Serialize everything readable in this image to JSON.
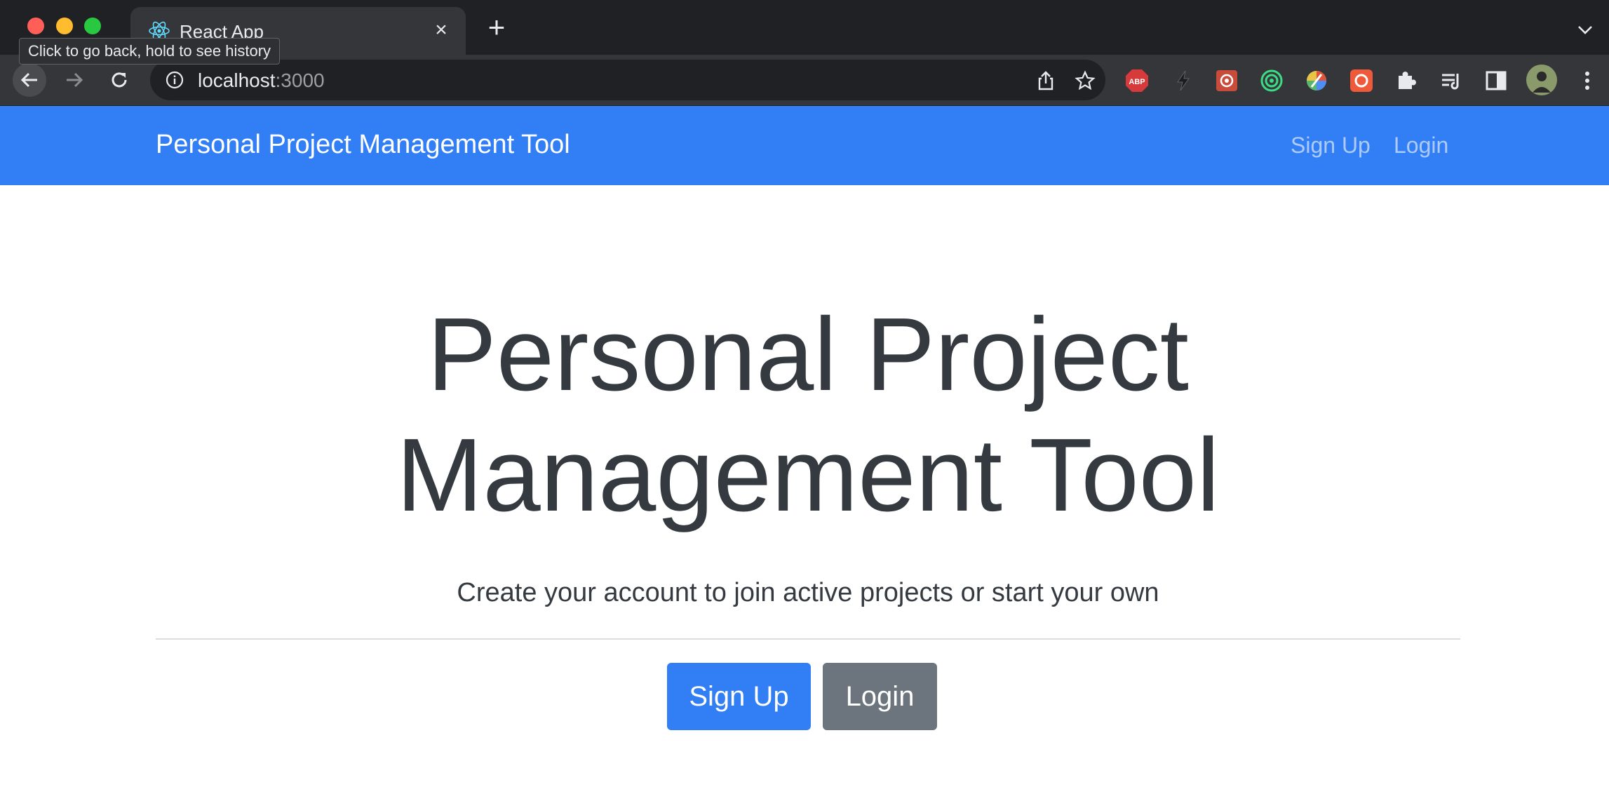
{
  "browser": {
    "tab_title": "React App",
    "close_glyph": "×",
    "new_tab_glyph": "+",
    "tooltip": "Click to go back, hold to see history",
    "url_host": "localhost",
    "url_port": ":3000",
    "extensions": [
      "abp-icon",
      "bolt-icon",
      "extension-red-icon",
      "target-icon",
      "color-picker-icon",
      "record-icon",
      "puzzle-icon",
      "reading-list-icon",
      "side-panel-icon",
      "avatar",
      "more-icon"
    ],
    "colors": {
      "frame": "#202124",
      "toolbar": "#35363a"
    }
  },
  "navbar": {
    "brand": "Personal Project Management Tool",
    "links": [
      "Sign Up",
      "Login"
    ],
    "color": "#317ef5"
  },
  "hero": {
    "title": "Personal Project Management Tool",
    "lead": "Create your account to join active projects or start your own",
    "buttons": {
      "primary": "Sign Up",
      "secondary": "Login"
    },
    "colors": {
      "primary": "#317ef5",
      "secondary": "#6c757d"
    }
  }
}
